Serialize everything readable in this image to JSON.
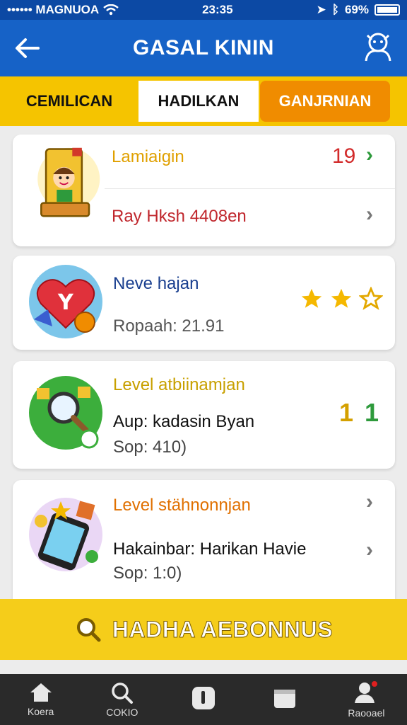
{
  "status_bar": {
    "carrier": "•••••• MAGNUOA",
    "time": "23:35",
    "battery": "69%"
  },
  "header": {
    "title": "GASAL KININ"
  },
  "tabs": [
    {
      "label": "CEMILICAN"
    },
    {
      "label": "HADILKAN"
    },
    {
      "label": "GANJRNIAN"
    }
  ],
  "cards": [
    {
      "title": "Lamiaigin",
      "count": "19",
      "line2": "Ray Hksh 4408en"
    },
    {
      "title": "Neve hajan",
      "line2": "Ropaah: 21.91"
    },
    {
      "title": "Level atbiinamjan",
      "line2": "Aup: kadasin Byan",
      "line3": "Sop: 410)",
      "value1": "1",
      "value2": "1"
    },
    {
      "title": "Level stähnonnjan",
      "line2": "Hakainbar: Harikan Havie",
      "line3": "Sop: 1:0)"
    }
  ],
  "banner": {
    "label": "HADHA AEBONNUS"
  },
  "nav": [
    {
      "label": "Koera"
    },
    {
      "label": "COKIO"
    },
    {
      "label": ""
    },
    {
      "label": ""
    },
    {
      "label": "Raooael"
    }
  ],
  "colors": {
    "primary": "#1662c7",
    "yellow": "#f5c400",
    "orange": "#f08c00"
  }
}
